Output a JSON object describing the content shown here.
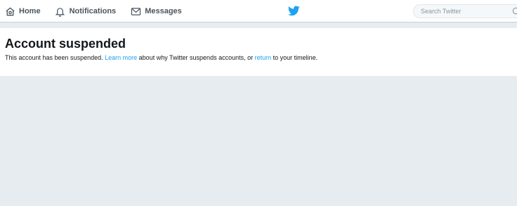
{
  "nav": {
    "home": {
      "label": "Home",
      "icon": "home-icon"
    },
    "notifications": {
      "label": "Notifications",
      "icon": "bell-icon"
    },
    "messages": {
      "label": "Messages",
      "icon": "envelope-icon"
    }
  },
  "brand": {
    "icon": "twitter-bird-icon",
    "color": "#1da1f2"
  },
  "search": {
    "placeholder": "Search Twitter",
    "value": "",
    "icon": "search-icon"
  },
  "notice": {
    "title": "Account suspended",
    "text_1": "This account has been suspended.",
    "link_learn_more": "Learn more",
    "text_2": "about why Twitter suspends accounts, or",
    "link_return": "return",
    "text_3": "to your timeline."
  },
  "colors": {
    "link": "#1da1f2",
    "background": "#e6ecf0",
    "text": "#14171a"
  }
}
